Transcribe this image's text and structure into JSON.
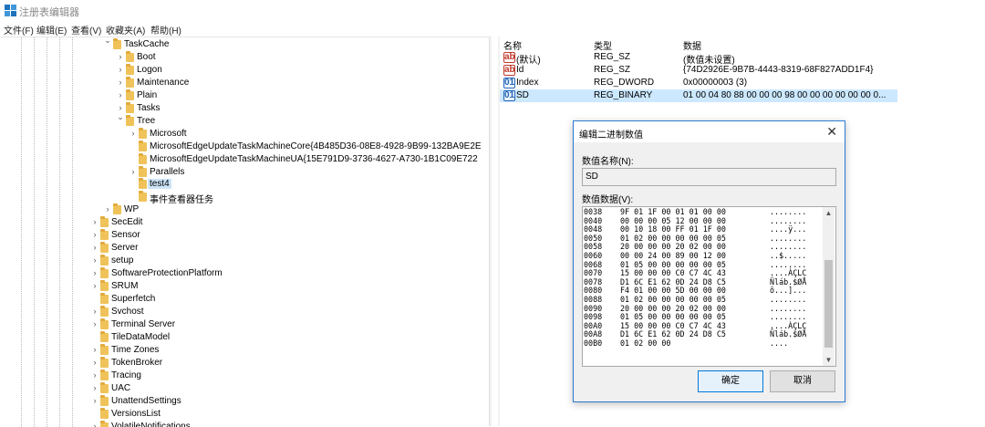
{
  "window": {
    "title": "注册表编辑器"
  },
  "menu": [
    "文件(F)",
    "编辑(E)",
    "查看(V)",
    "收藏夹(A)",
    "帮助(H)"
  ],
  "tree": [
    {
      "label": "TaskCache",
      "state": "expanded",
      "level": 2
    },
    {
      "label": "Boot",
      "state": "collapsed",
      "level": 3
    },
    {
      "label": "Logon",
      "state": "collapsed",
      "level": 3
    },
    {
      "label": "Maintenance",
      "state": "collapsed",
      "level": 3
    },
    {
      "label": "Plain",
      "state": "collapsed",
      "level": 3
    },
    {
      "label": "Tasks",
      "state": "collapsed",
      "level": 3
    },
    {
      "label": "Tree",
      "state": "expanded",
      "level": 3
    },
    {
      "label": "Microsoft",
      "state": "collapsed",
      "level": 4
    },
    {
      "label": "MicrosoftEdgeUpdateTaskMachineCore{4B485D36-08E8-4928-9B99-132BA9E2E",
      "state": "none",
      "level": 4
    },
    {
      "label": "MicrosoftEdgeUpdateTaskMachineUA{15E791D9-3736-4627-A730-1B1C09E722",
      "state": "none",
      "level": 4
    },
    {
      "label": "Parallels",
      "state": "collapsed",
      "level": 4
    },
    {
      "label": "test4",
      "state": "none",
      "level": 4,
      "selected": true
    },
    {
      "label": "事件查看器任务",
      "state": "none",
      "level": 4
    },
    {
      "label": "WP",
      "state": "collapsed",
      "level": 2
    },
    {
      "label": "SecEdit",
      "state": "collapsed",
      "level": 1
    },
    {
      "label": "Sensor",
      "state": "collapsed",
      "level": 1
    },
    {
      "label": "Server",
      "state": "collapsed",
      "level": 1
    },
    {
      "label": "setup",
      "state": "collapsed",
      "level": 1
    },
    {
      "label": "SoftwareProtectionPlatform",
      "state": "collapsed",
      "level": 1
    },
    {
      "label": "SRUM",
      "state": "collapsed",
      "level": 1
    },
    {
      "label": "Superfetch",
      "state": "none",
      "level": 1
    },
    {
      "label": "Svchost",
      "state": "collapsed",
      "level": 1
    },
    {
      "label": "Terminal Server",
      "state": "collapsed",
      "level": 1
    },
    {
      "label": "TileDataModel",
      "state": "none",
      "level": 1
    },
    {
      "label": "Time Zones",
      "state": "collapsed",
      "level": 1
    },
    {
      "label": "TokenBroker",
      "state": "collapsed",
      "level": 1
    },
    {
      "label": "Tracing",
      "state": "collapsed",
      "level": 1
    },
    {
      "label": "UAC",
      "state": "collapsed",
      "level": 1
    },
    {
      "label": "UnattendSettings",
      "state": "collapsed",
      "level": 1
    },
    {
      "label": "VersionsList",
      "state": "none",
      "level": 1
    },
    {
      "label": "VolatileNotifications",
      "state": "collapsed",
      "level": 1
    }
  ],
  "columns": {
    "name": "名称",
    "type": "类型",
    "data": "数据"
  },
  "values": [
    {
      "icon": "ab",
      "name": "(默认)",
      "type": "REG_SZ",
      "data": "(数值未设置)"
    },
    {
      "icon": "ab",
      "name": "Id",
      "type": "REG_SZ",
      "data": "{74D2926E-9B7B-4443-8319-68F827ADD1F4}"
    },
    {
      "icon": "bin",
      "name": "Index",
      "type": "REG_DWORD",
      "data": "0x00000003 (3)"
    },
    {
      "icon": "bin",
      "name": "SD",
      "type": "REG_BINARY",
      "data": "01 00 04 80 88 00 00 00 98 00 00 00 00 00 00 0...",
      "selected": true
    }
  ],
  "dialog": {
    "title": "编辑二进制数值",
    "name_label": "数值名称(N):",
    "name_value": "SD",
    "data_label": "数值数据(V):",
    "ok": "确定",
    "cancel": "取消",
    "hex_rows": [
      {
        "addr": "0038",
        "bytes": "9F 01 1F 00 01 01 00 00",
        "ascii": "........"
      },
      {
        "addr": "0040",
        "bytes": "00 00 00 05 12 00 00 00",
        "ascii": "........"
      },
      {
        "addr": "0048",
        "bytes": "00 10 18 00 FF 01 1F 00",
        "ascii": "....ÿ..."
      },
      {
        "addr": "0050",
        "bytes": "01 02 00 00 00 00 00 05",
        "ascii": "........"
      },
      {
        "addr": "0058",
        "bytes": "20 00 00 00 20 02 00 00",
        "ascii": "........"
      },
      {
        "addr": "0060",
        "bytes": "00 00 24 00 89 00 12 00",
        "ascii": "..$....."
      },
      {
        "addr": "0068",
        "bytes": "01 05 00 00 00 00 00 05",
        "ascii": "........"
      },
      {
        "addr": "0070",
        "bytes": "15 00 00 00 C0 C7 4C 43",
        "ascii": "....ÀÇLC"
      },
      {
        "addr": "0078",
        "bytes": "D1 6C E1 62 0D 24 D8 C5",
        "ascii": "Ñláb.$ØÅ"
      },
      {
        "addr": "0080",
        "bytes": "F4 01 00 00 5D 00 00 00",
        "ascii": "ô...]..."
      },
      {
        "addr": "0088",
        "bytes": "01 02 00 00 00 00 00 05",
        "ascii": "........"
      },
      {
        "addr": "0090",
        "bytes": "20 00 00 00 20 02 00 00",
        "ascii": "........"
      },
      {
        "addr": "0098",
        "bytes": "01 05 00 00 00 00 00 05",
        "ascii": "........"
      },
      {
        "addr": "00A0",
        "bytes": "15 00 00 00 C0 C7 4C 43",
        "ascii": "....ÀÇLC"
      },
      {
        "addr": "00A8",
        "bytes": "D1 6C E1 62 0D 24 D8 C5",
        "ascii": "Ñláb.$ØÅ"
      },
      {
        "addr": "00B0",
        "bytes": "01 02 00 00",
        "ascii": "...."
      }
    ]
  },
  "colors": {
    "accent": "#0078d7",
    "selection": "#cce8ff",
    "folder": "#f0c35a"
  }
}
